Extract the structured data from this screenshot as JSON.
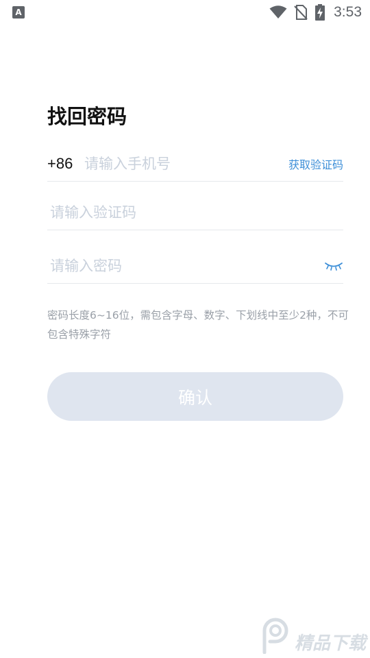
{
  "status_bar": {
    "left_icon_label": "A",
    "time": "3:53"
  },
  "page": {
    "title": "找回密码"
  },
  "form": {
    "country_code": "+86",
    "phone_placeholder": "请输入手机号",
    "get_code_label": "获取验证码",
    "code_placeholder": "请输入验证码",
    "password_placeholder": "请输入密码",
    "hint": "密码长度6~16位，需包含字母、数字、下划线中至少2种，不可包含特殊字符",
    "confirm_label": "确认"
  },
  "watermark": {
    "text": "精品下载"
  },
  "colors": {
    "accent": "#3d8fd8",
    "placeholder": "#c9d1dc",
    "button_disabled": "#dfe5ef",
    "hint": "#9aa0a8"
  }
}
